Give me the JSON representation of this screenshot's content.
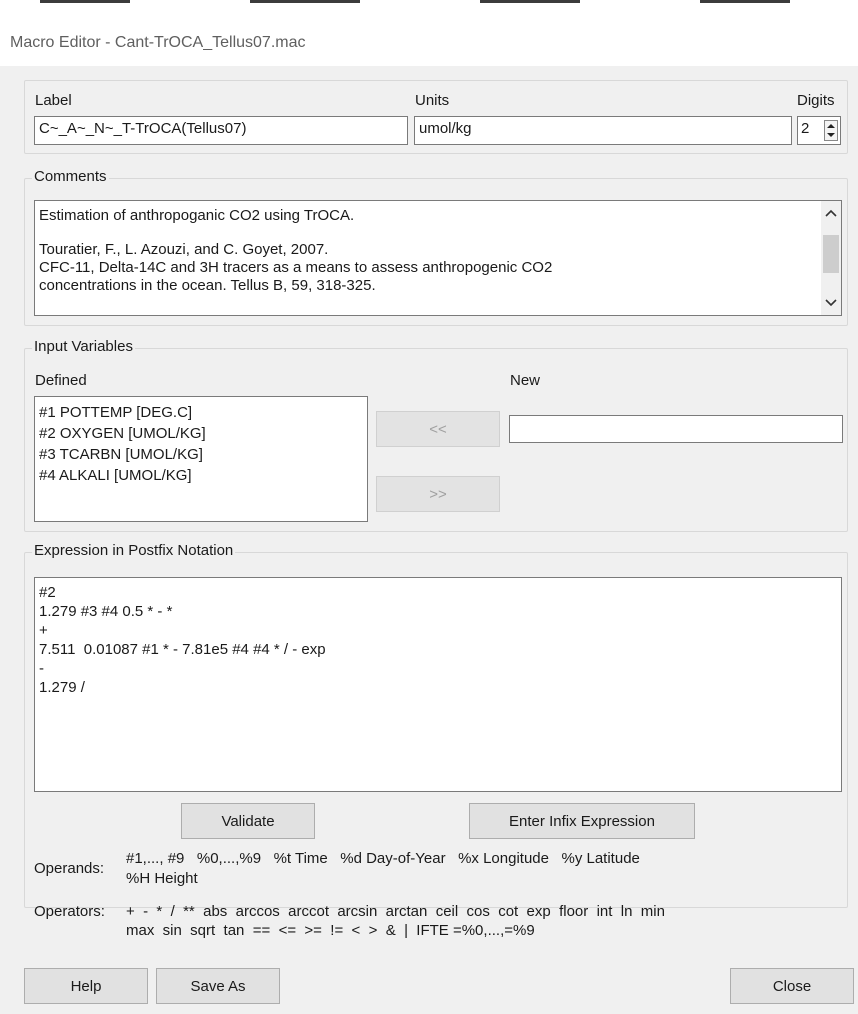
{
  "window": {
    "title": "Macro Editor - Cant-TrOCA_Tellus07.mac"
  },
  "header": {
    "label_caption": "Label",
    "label_value": "C~_A~_N~_T-TrOCA(Tellus07)",
    "units_caption": "Units",
    "units_value": "umol/kg",
    "digits_caption": "Digits",
    "digits_value": "2"
  },
  "comments": {
    "legend": "Comments",
    "lines": [
      "Estimation of anthropoganic CO2 using TrOCA.",
      "",
      "Touratier, F., L. Azouzi, and C. Goyet, 2007.",
      "CFC-11, Delta-14C and 3H tracers as a means to assess anthropogenic CO2",
      "concentrations in the ocean. Tellus B, 59, 318-325."
    ]
  },
  "input_variables": {
    "legend": "Input Variables",
    "defined_caption": "Defined",
    "new_caption": "New",
    "defined": [
      "#1 POTTEMP [DEG.C]",
      "#2 OXYGEN [UMOL/KG]",
      "#3 TCARBN [UMOL/KG]",
      "#4 ALKALI [UMOL/KG]"
    ],
    "add_label": "<<",
    "remove_label": ">>",
    "new_value": ""
  },
  "expression": {
    "legend": "Expression in Postfix Notation",
    "lines": [
      "#2",
      "1.279 #3 #4 0.5 * - *",
      "+",
      "7.511  0.01087 #1 * - 7.81e5 #4 #4 * / - exp",
      "-",
      "1.279 /"
    ],
    "validate_label": "Validate",
    "infix_label": "Enter Infix Expression"
  },
  "reference": {
    "operands_caption": "Operands:",
    "operands_line1": "#1,..., #9   %0,...,%9   %t Time   %d Day-of-Year   %x Longitude   %y Latitude",
    "operands_line2": "%H Height",
    "operators_caption": "Operators:",
    "operators_line1": "+  -  *  /  **  abs  arccos  arccot  arcsin  arctan  ceil  cos  cot  exp  floor  int  ln  min",
    "operators_line2": "max  sin  sqrt  tan  ==  <=  >=  !=  <  >  &  |  IFTE =%0,...,=%9"
  },
  "footer": {
    "help_label": "Help",
    "save_as_label": "Save As",
    "close_label": "Close"
  },
  "icons": {
    "spin": "spin-up-down-icon",
    "scroll_up": "chevron-up-icon",
    "scroll_down": "chevron-down-icon"
  }
}
